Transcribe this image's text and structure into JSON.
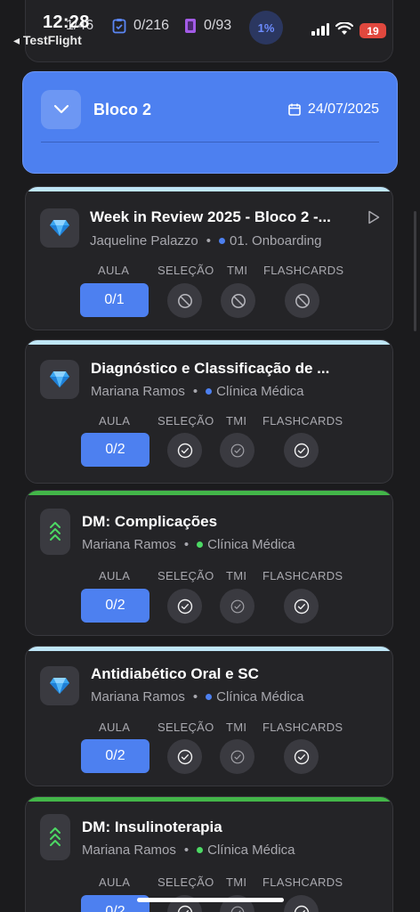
{
  "status_bar": {
    "time": "12:28",
    "back_app": "◂ TestFlight",
    "stat_1": "1/46",
    "stat_2": "0/216",
    "stat_3": "0/93",
    "progress_pct": "1%",
    "battery": "19"
  },
  "block": {
    "title": "Bloco 2",
    "date": "24/07/2025",
    "expand_icon": "chevron-down-icon"
  },
  "columns": {
    "aula": "AULA",
    "selecao": "SELEÇÃO",
    "tmi": "TMI",
    "flashcards": "FLASHCARDS"
  },
  "lessons": [
    {
      "title": "Week in Review 2025 - Bloco 2 -...",
      "author": "Jaqueline Palazzo",
      "category": "01. Onboarding",
      "aula_progress": "0/1",
      "icon": "diamond-icon",
      "accent_color": "#bfe6f7",
      "dot_color": "#4d80f0",
      "status_icons": [
        "blocked-icon",
        "blocked-icon",
        "blocked-icon"
      ]
    },
    {
      "title": "Diagnóstico e Classificação de ...",
      "author": "Mariana Ramos",
      "category": "Clínica Médica",
      "aula_progress": "0/2",
      "icon": "diamond-icon",
      "accent_color": "#bfe6f7",
      "dot_color": "#4d80f0",
      "status_icons": [
        "check-icon",
        "check-icon",
        "check-icon"
      ]
    },
    {
      "title": "DM: Complicações",
      "author": "Mariana Ramos",
      "category": "Clínica Médica",
      "aula_progress": "0/2",
      "icon": "triple-chevron-up-icon",
      "accent_color": "#43b649",
      "dot_color": "#4cd964",
      "status_icons": [
        "check-icon",
        "check-icon",
        "check-icon"
      ]
    },
    {
      "title": "Antidiabético Oral e SC",
      "author": "Mariana Ramos",
      "category": "Clínica Médica",
      "aula_progress": "0/2",
      "icon": "diamond-icon",
      "accent_color": "#bfe6f7",
      "dot_color": "#4d80f0",
      "status_icons": [
        "check-icon",
        "check-icon",
        "check-icon"
      ]
    },
    {
      "title": "DM: Insulinoterapia",
      "author": "Mariana Ramos",
      "category": "Clínica Médica",
      "aula_progress": "0/2",
      "icon": "triple-chevron-up-icon",
      "accent_color": "#43b649",
      "dot_color": "#4cd964",
      "status_icons": [
        "check-icon",
        "check-icon",
        "check-icon"
      ]
    }
  ]
}
